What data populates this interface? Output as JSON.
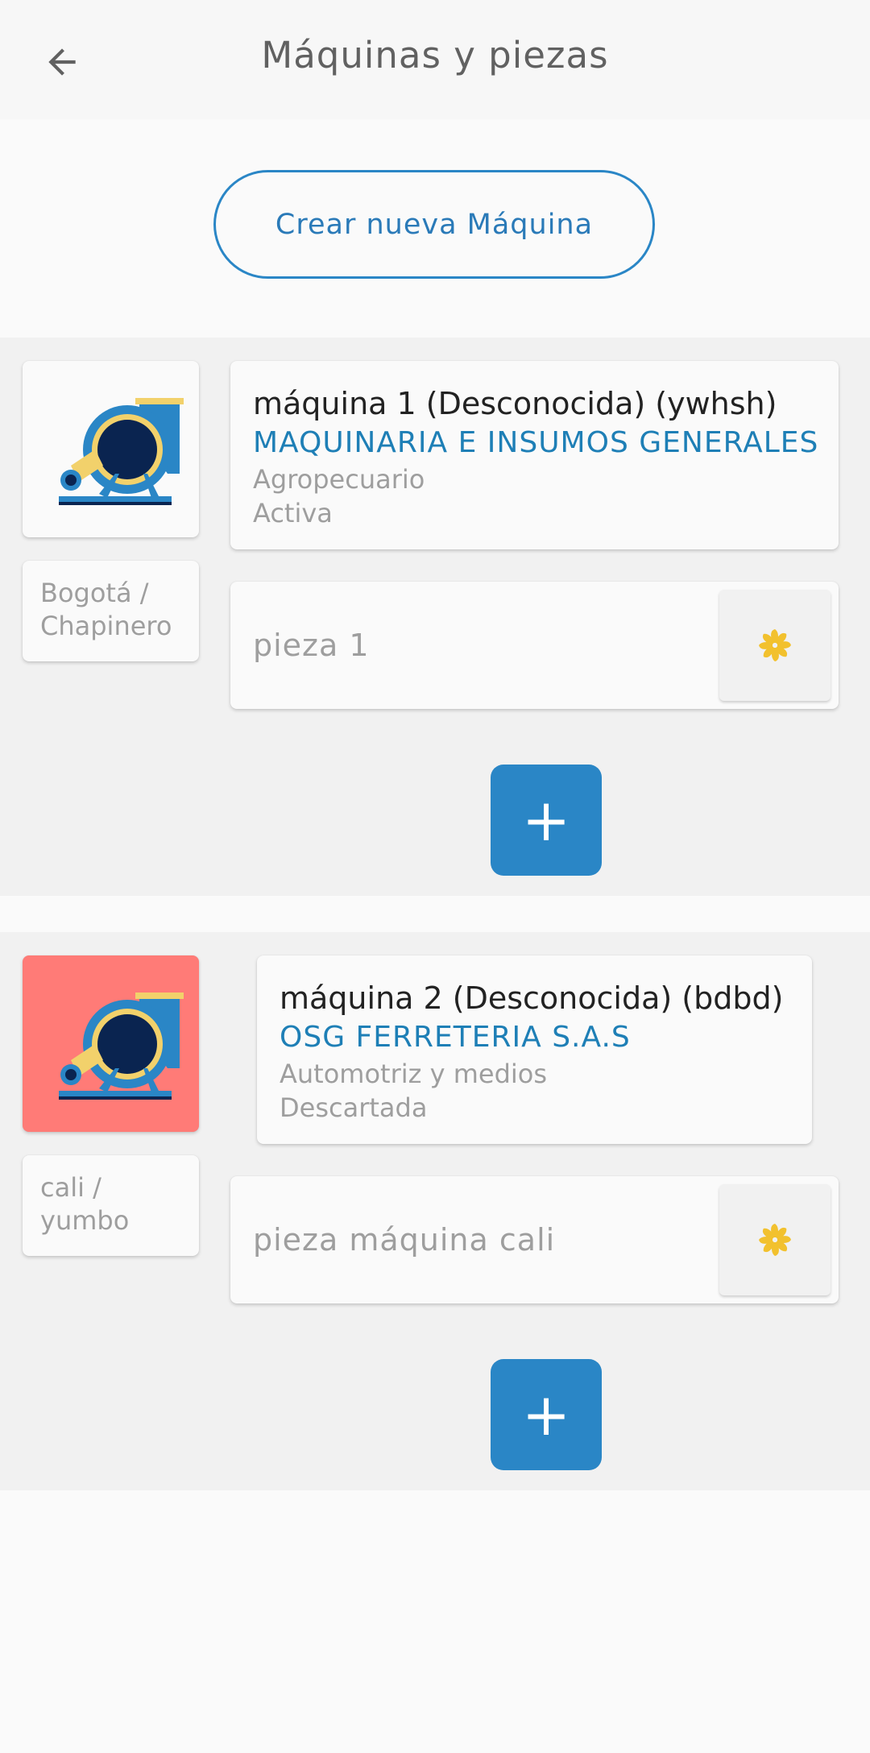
{
  "appbar": {
    "title": "Máquinas y piezas",
    "back_icon": "arrow-left-icon"
  },
  "create_button": {
    "label": "Crear nueva Máquina"
  },
  "colors": {
    "accent": "#2a86c6",
    "company": "#1e7fb6",
    "discarded_bg": "#ff7b77"
  },
  "machines": [
    {
      "title": "máquina 1 (Desconocida) (ywhsh)",
      "company": "MAQUINARIA E INSUMOS GENERALES",
      "sector": "Agropecuario",
      "status": "Activa",
      "location_line1": "Bogotá  /",
      "location_line2": "Chapinero",
      "image_icon": "industrial-fan-icon",
      "pieces": [
        {
          "label": "pieza 1",
          "action_icon": "spinner-icon"
        }
      ],
      "add_label": "+"
    },
    {
      "title": "máquina 2 (Desconocida) (bdbd)",
      "company": "OSG FERRETERIA S.A.S",
      "sector": "Automotriz y medios",
      "status": "Descartada",
      "location_line1": "cali /",
      "location_line2": "yumbo",
      "image_icon": "industrial-fan-icon",
      "pieces": [
        {
          "label": "pieza máquina cali",
          "action_icon": "spinner-icon"
        }
      ],
      "add_label": "+"
    }
  ]
}
